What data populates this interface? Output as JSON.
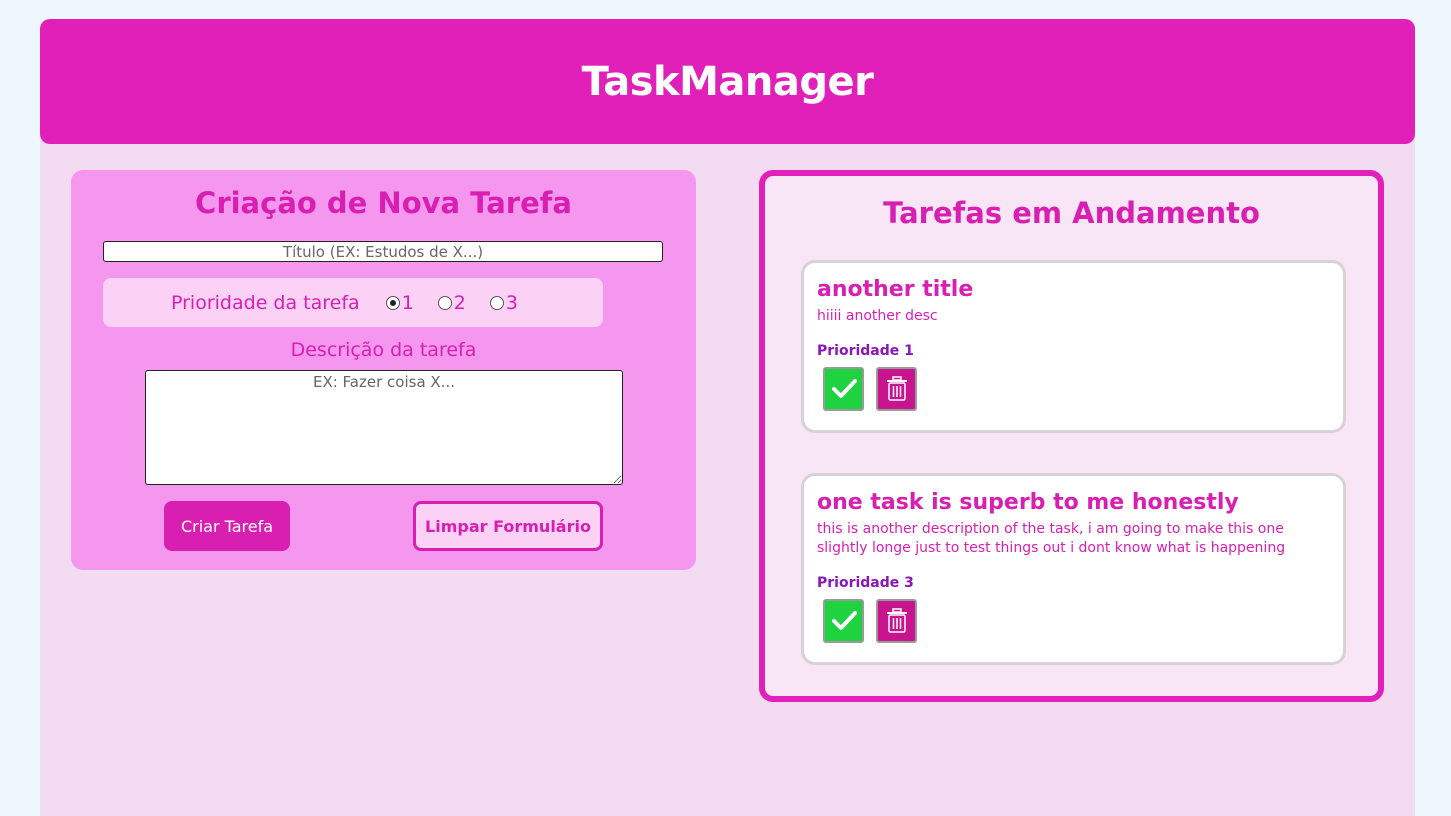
{
  "header": {
    "title": "TaskManager"
  },
  "form": {
    "title": "Criação de Nova Tarefa",
    "title_placeholder": "Título (EX: Estudos de X...)",
    "priority_label": "Prioridade da tarefa",
    "priority_options": [
      {
        "label": "1",
        "checked": true
      },
      {
        "label": "2",
        "checked": false
      },
      {
        "label": "3",
        "checked": false
      }
    ],
    "description_label": "Descrição da tarefa",
    "description_placeholder": "EX: Fazer coisa X...",
    "create_button": "Criar Tarefa",
    "clear_button": "Limpar Formulário"
  },
  "tasks": {
    "title": "Tarefas em Andamento",
    "items": [
      {
        "title": "another title",
        "description": "hiiii another desc",
        "priority": "Prioridade 1",
        "done_icon": "check-icon",
        "delete_icon": "trash-icon"
      },
      {
        "title": "one task is superb to me honestly",
        "description": "this is another description of the task, i am going to make this one slightly longe just to test things out i dont know what is happening",
        "priority": "Prioridade 3",
        "done_icon": "check-icon",
        "delete_icon": "trash-icon"
      }
    ]
  },
  "colors": {
    "header": "#e11fb9",
    "accent": "#d81fb1",
    "form_panel": "#f596ef",
    "done_button": "#1ed33f",
    "delete_button": "#c8148f",
    "priority_text": "#8a16b8"
  }
}
